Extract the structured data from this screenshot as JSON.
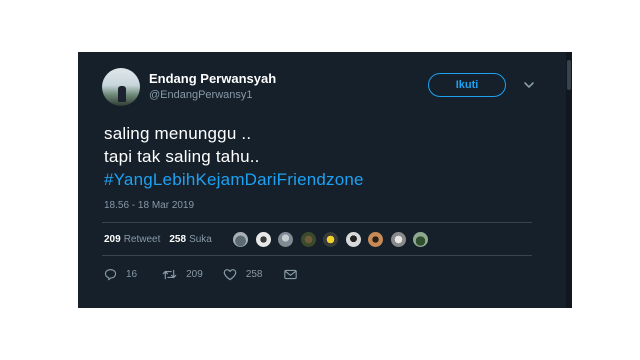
{
  "user": {
    "display_name": "Endang Perwansyah",
    "handle": "@EndangPerwansy1"
  },
  "follow_button": {
    "label": "Ikuti"
  },
  "tweet": {
    "lines": [
      "saling menunggu ..",
      "tapi tak saling tahu.."
    ],
    "hashtag": "#YangLebihKejamDariFriendzone",
    "timestamp": "18.56 - 18 Mar 2019"
  },
  "stats": {
    "retweets": "209",
    "retweets_label": "Retweet",
    "likes": "258",
    "likes_label": "Suka"
  },
  "likers": [
    {
      "avatar": "liker-1"
    },
    {
      "avatar": "liker-2"
    },
    {
      "avatar": "liker-3"
    },
    {
      "avatar": "liker-4"
    },
    {
      "avatar": "liker-5"
    },
    {
      "avatar": "liker-6"
    },
    {
      "avatar": "liker-7"
    },
    {
      "avatar": "liker-8"
    },
    {
      "avatar": "liker-9"
    }
  ],
  "actions": {
    "reply": {
      "icon": "reply-icon",
      "count": "16"
    },
    "retweet": {
      "icon": "retweet-icon",
      "count": "209"
    },
    "like": {
      "icon": "heart-icon",
      "count": "258"
    },
    "message": {
      "icon": "envelope-icon"
    }
  },
  "colors": {
    "background": "#15202b",
    "accent": "#1da1f2",
    "muted": "#8899a6",
    "divider": "#38444d"
  }
}
